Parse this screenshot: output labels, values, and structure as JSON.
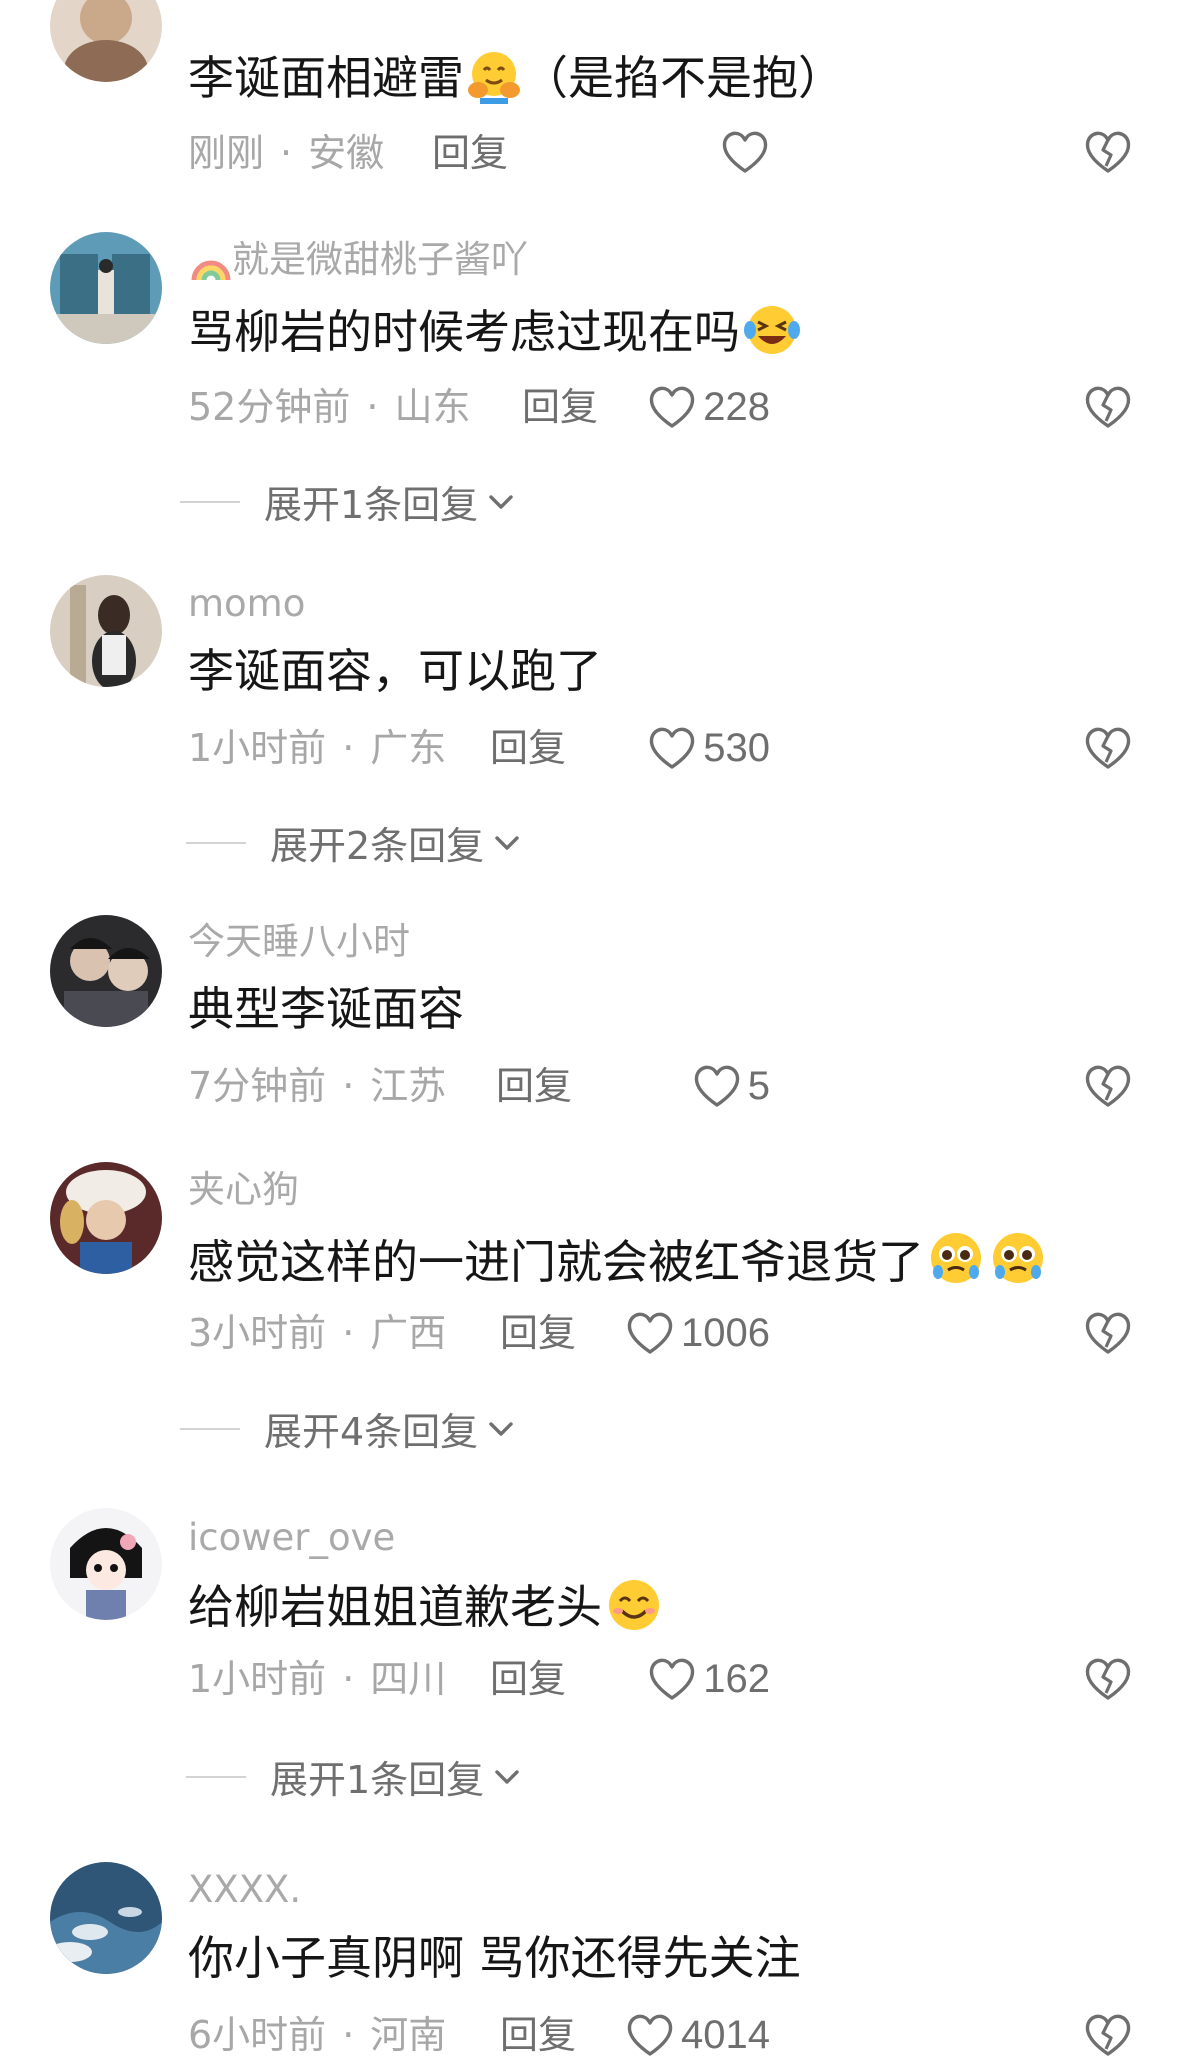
{
  "comments": [
    {
      "username": "",
      "text": "李诞面相避雷",
      "text_suffix": "（是掐不是抱）",
      "emoji": "hugging-face",
      "time": "刚刚",
      "location": "安徽",
      "reply_label": "回复",
      "likes": "",
      "expand": ""
    },
    {
      "username": "就是微甜桃子酱吖",
      "text": "骂柳岩的时候考虑过现在吗",
      "emoji": "laughing-crying-face",
      "time": "52分钟前",
      "location": "山东",
      "reply_label": "回复",
      "likes": "228",
      "expand": "展开1条回复"
    },
    {
      "username": "momo",
      "text": "李诞面容，可以跑了",
      "time": "1小时前",
      "location": "广东",
      "reply_label": "回复",
      "likes": "530",
      "expand": "展开2条回复"
    },
    {
      "username": "今天睡八小时",
      "text": "典型李诞面容",
      "time": "7分钟前",
      "location": "江苏",
      "reply_label": "回复",
      "likes": "5",
      "expand": ""
    },
    {
      "username": "夹心狗",
      "text": "感觉这样的一进门就会被红爷退货了",
      "emoji": "pleading-face",
      "time": "3小时前",
      "location": "广西",
      "reply_label": "回复",
      "likes": "1006",
      "expand": "展开4条回复"
    },
    {
      "username": "icower_ove",
      "text": "给柳岩姐姐道歉老头",
      "emoji": "smiling-face",
      "time": "1小时前",
      "location": "四川",
      "reply_label": "回复",
      "likes": "162",
      "expand": "展开1条回复"
    },
    {
      "username": "XXXX.",
      "text": "你小子真阴啊  骂你还得先关注",
      "time": "6小时前",
      "location": "河南",
      "reply_label": "回复",
      "likes": "4014",
      "expand": ""
    }
  ],
  "meta_separator": "·",
  "icons": {
    "like": "heart-outline-icon",
    "dislike": "broken-heart-icon",
    "expand": "chevron-down-icon"
  },
  "colors": {
    "text": "#161616",
    "secondary": "#a7a7a7",
    "action": "#6e6e6e"
  }
}
